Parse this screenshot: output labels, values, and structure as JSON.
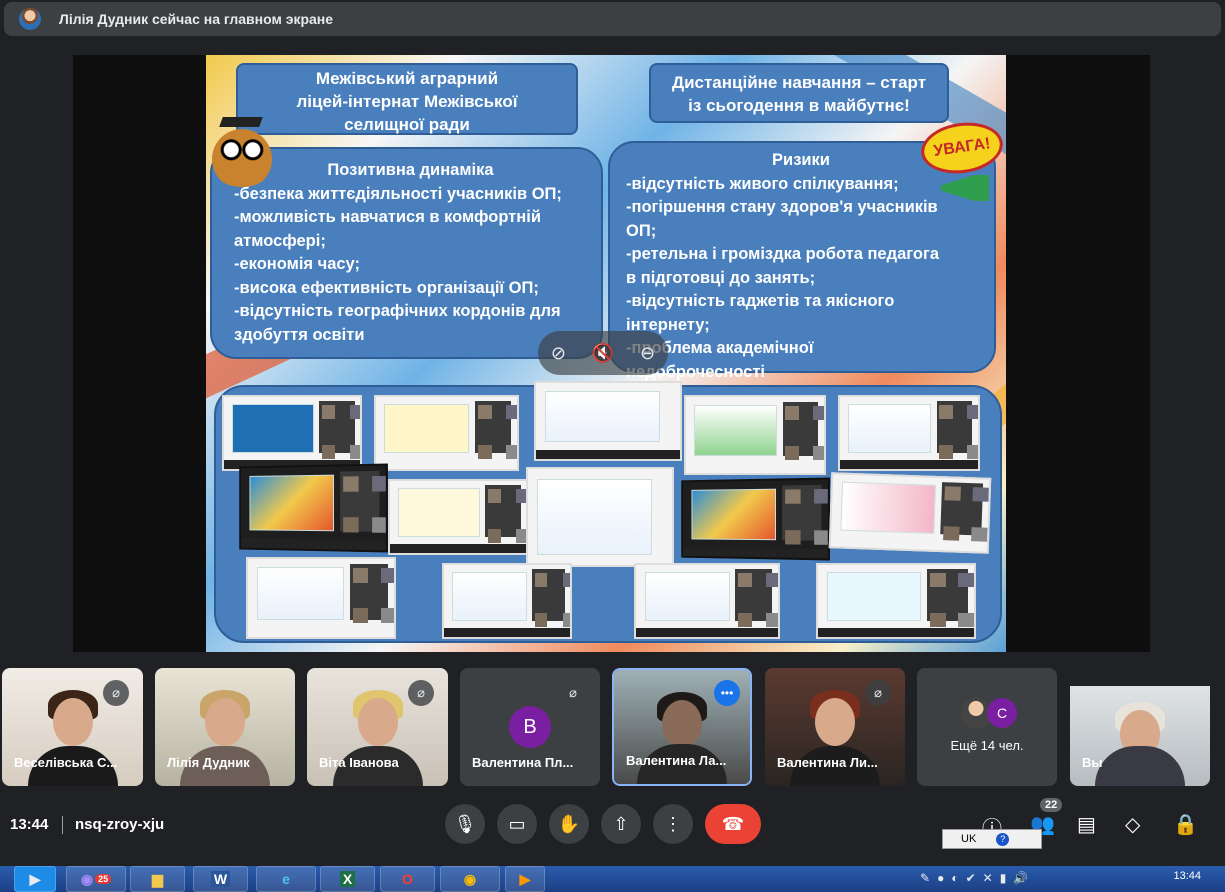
{
  "presenter": {
    "text": "Лілія Дудник сейчас на главном экране"
  },
  "slide": {
    "title_left": [
      "Межівський аграрний",
      "ліцей-інтернат Межівської",
      "селищної ради"
    ],
    "title_right": [
      "Дистанційне навчання – старт",
      "із сьогодення в майбутнє!"
    ],
    "warning": "УВАГА!",
    "positive": {
      "heading": "Позитивна динаміка",
      "lines": [
        "-безпека життєдіяльності учасників ОП;",
        "-можливість навчатися в комфортній",
        "атмосфері;",
        "-економія часу;",
        "-висока ефективність організації ОП;",
        "-відсутність географічних кордонів для",
        "здобуття освіти"
      ]
    },
    "risks": {
      "heading": "Ризики",
      "lines": [
        "-відсутність живого спілкування;",
        "-погіршення стану здоров'я учасників",
        "ОП;",
        "-ретельна і громіздка робота педагога",
        "в підготовці до занять;",
        "-відсутність гаджетів та якісного",
        "інтернету;",
        "-проблема академічної",
        "недоброчесності"
      ]
    }
  },
  "participants": [
    {
      "name": "Веселівська С...",
      "muted": true
    },
    {
      "name": "Лілія Дудник",
      "muted": false
    },
    {
      "name": "Віта Іванова",
      "muted": true
    },
    {
      "name": "Валентина Пл...",
      "muted": true,
      "avatar_letter": "В"
    },
    {
      "name": "Валентина Ла...",
      "speaking": true
    },
    {
      "name": "Валентина Ли...",
      "muted": true
    },
    {
      "name": "Ещё 14 чел.",
      "avatar_letter": "С"
    },
    {
      "name": "Вы"
    }
  ],
  "meeting": {
    "time": "13:44",
    "code": "nsq-zroy-xju",
    "participant_count": "22"
  },
  "system": {
    "lang": "UK",
    "clock": "13:44",
    "taskbar_badge": "25"
  },
  "icons": {
    "mic": "microphone-icon",
    "camera": "camera-icon",
    "hand": "raise-hand-icon",
    "present": "present-screen-icon",
    "more": "more-options-icon",
    "end": "end-call-icon",
    "info": "info-icon",
    "people": "people-icon",
    "chat": "chat-icon",
    "activities": "activities-icon",
    "lock": "host-controls-icon"
  },
  "colors": {
    "bg": "#202124",
    "tile": "#3c4043",
    "end_call": "#ea4335",
    "slide_box": "#4a7fbd",
    "speaking": "#1a73e8"
  }
}
